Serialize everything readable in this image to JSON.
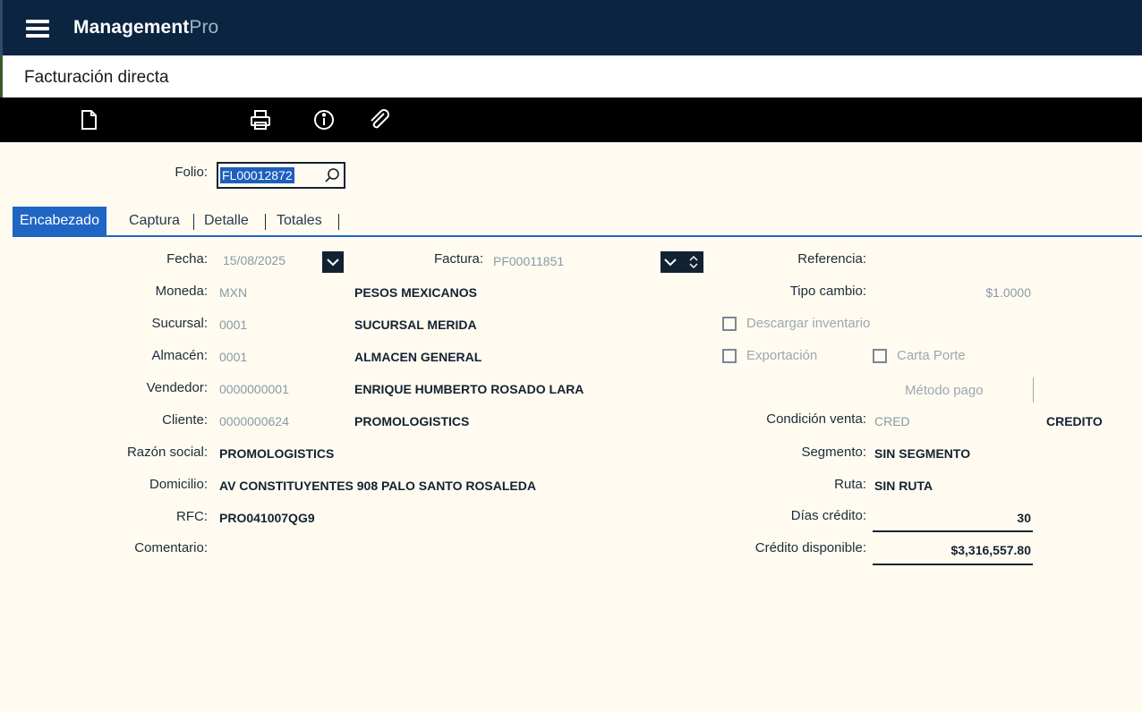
{
  "app": {
    "brand_main": "Management",
    "brand_accent": "Pro"
  },
  "page": {
    "title": "Facturación directa"
  },
  "toolbar": {
    "icons": [
      "new-document-icon",
      "print-icon",
      "info-icon",
      "attachment-icon"
    ]
  },
  "folio": {
    "label": "Folio:",
    "value": "FL00012872"
  },
  "tabs": [
    "Encabezado",
    "Captura",
    "Detalle",
    "Totales"
  ],
  "header": {
    "fecha": {
      "label": "Fecha:",
      "value": "15/08/2025"
    },
    "factura": {
      "label": "Factura:",
      "value": "PF00011851"
    },
    "referencia": {
      "label": "Referencia:",
      "value": ""
    },
    "moneda": {
      "label": "Moneda:",
      "code": "MXN",
      "name": "PESOS MEXICANOS"
    },
    "tipo_cambio": {
      "label": "Tipo cambio:",
      "value": "$1.0000"
    },
    "sucursal": {
      "label": "Sucursal:",
      "code": "0001",
      "name": "SUCURSAL MERIDA"
    },
    "almacen": {
      "label": "Almacén:",
      "code": "0001",
      "name": "ALMACEN GENERAL"
    },
    "vendedor": {
      "label": "Vendedor:",
      "code": "0000000001",
      "name": "ENRIQUE HUMBERTO ROSADO LARA"
    },
    "cliente": {
      "label": "Cliente:",
      "code": "0000000624",
      "name": "PROMOLOGISTICS"
    },
    "razon_social": {
      "label": "Razón social:",
      "value": "PROMOLOGISTICS"
    },
    "domicilio": {
      "label": "Domicilio:",
      "value": "AV CONSTITUYENTES 908 PALO SANTO ROSALEDA"
    },
    "rfc": {
      "label": "RFC:",
      "value": "PRO041007QG9"
    },
    "comentario": {
      "label": "Comentario:",
      "value": ""
    },
    "descargar_inventario": {
      "label": "Descargar inventario",
      "checked": false
    },
    "exportacion": {
      "label": "Exportación",
      "checked": false
    },
    "carta_porte": {
      "label": "Carta Porte",
      "checked": false
    },
    "metodo_pago": {
      "label": "Método pago"
    },
    "condicion_venta": {
      "label": "Condición venta:",
      "code": "CRED",
      "name": "CREDITO"
    },
    "segmento": {
      "label": "Segmento:",
      "value": "SIN SEGMENTO"
    },
    "ruta": {
      "label": "Ruta:",
      "value": "SIN RUTA"
    },
    "dias_credito": {
      "label": "Días crédito:",
      "value": "30"
    },
    "credito_disponible": {
      "label": "Crédito disponible:",
      "value": "$3,316,557.80"
    }
  },
  "colors": {
    "topbar": "#0b2440",
    "accent": "#1f66c4",
    "background": "#fffbf0"
  }
}
